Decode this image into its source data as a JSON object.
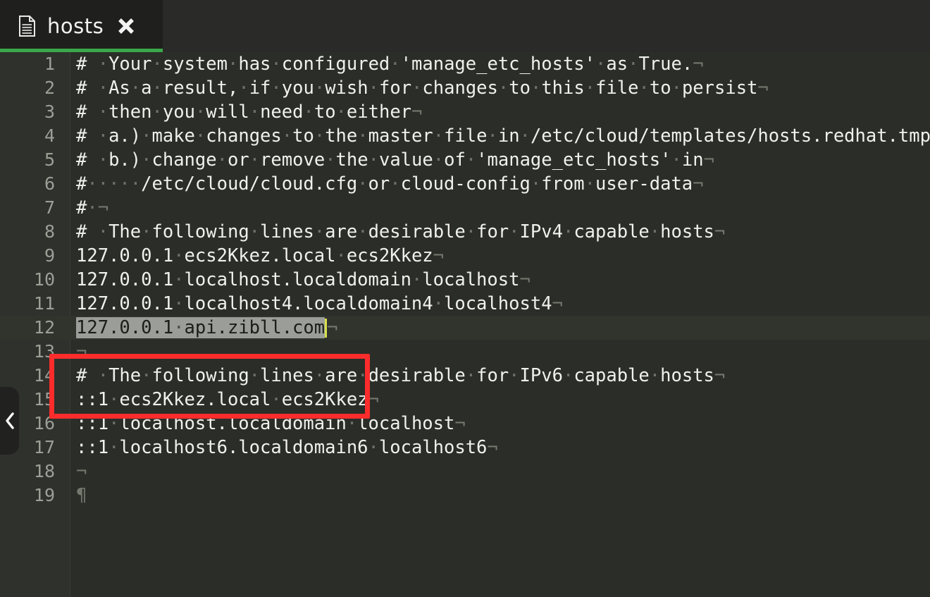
{
  "window": {
    "background_color": "#2b2d28",
    "tabbar_color": "#2a2b29"
  },
  "tab": {
    "title": "hosts",
    "file_icon": "document-icon",
    "close_icon": "close-icon",
    "active_underline_color": "#3aa84a",
    "active": true
  },
  "collapse_handle": {
    "icon": "chevron-left-icon"
  },
  "annotation": {
    "type": "rectangle",
    "color": "#fb2c2c",
    "covers_lines": "11-13"
  },
  "editor": {
    "current_line": 12,
    "selection_text": "127.0.0.1 api.zibll.com",
    "selection_background": "#9b9d98",
    "whitespace_dot": "·",
    "eol_mark": "¬",
    "eof_mark": "¶",
    "lines": [
      {
        "n": "1",
        "text": "# Your system has configured 'manage_etc_hosts' as True."
      },
      {
        "n": "2",
        "text": "# As a result, if you wish for changes to this file to persist"
      },
      {
        "n": "3",
        "text": "# then you will need to either"
      },
      {
        "n": "4",
        "text": "# a.) make changes to the master file in /etc/cloud/templates/hosts.redhat.tmpl"
      },
      {
        "n": "5",
        "text": "# b.) change or remove the value of 'manage_etc_hosts' in"
      },
      {
        "n": "6",
        "text": "#     /etc/cloud/cloud.cfg or cloud-config from user-data"
      },
      {
        "n": "7",
        "text": "# "
      },
      {
        "n": "8",
        "text": "# The following lines are desirable for IPv4 capable hosts"
      },
      {
        "n": "9",
        "text": "127.0.0.1 ecs2Kkez.local ecs2Kkez"
      },
      {
        "n": "10",
        "text": "127.0.0.1 localhost.localdomain localhost"
      },
      {
        "n": "11",
        "text": "127.0.0.1 localhost4.localdomain4 localhost4"
      },
      {
        "n": "12",
        "text": "127.0.0.1 api.zibll.com"
      },
      {
        "n": "13",
        "text": ""
      },
      {
        "n": "14",
        "text": "# The following lines are desirable for IPv6 capable hosts"
      },
      {
        "n": "15",
        "text": "::1 ecs2Kkez.local ecs2Kkez"
      },
      {
        "n": "16",
        "text": "::1 localhost.localdomain localhost"
      },
      {
        "n": "17",
        "text": "::1 localhost6.localdomain6 localhost6"
      },
      {
        "n": "18",
        "text": ""
      },
      {
        "n": "19",
        "text": ""
      }
    ]
  }
}
